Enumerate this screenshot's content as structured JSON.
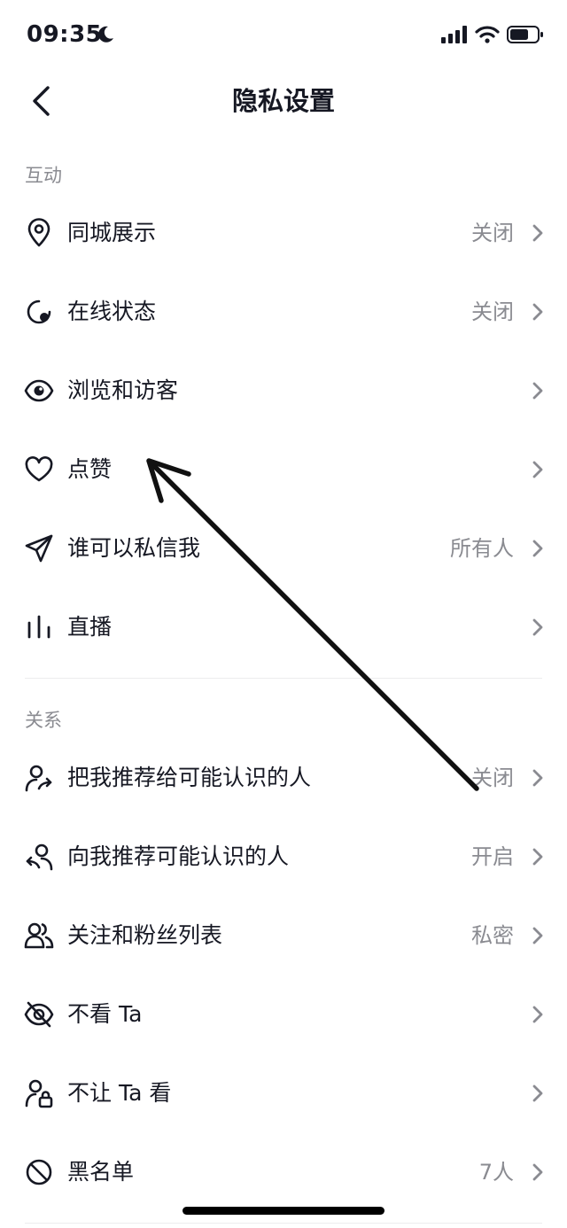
{
  "status": {
    "time": "09:35"
  },
  "nav": {
    "title": "隐私设置"
  },
  "sections": {
    "interaction": {
      "title": "互动",
      "items": [
        {
          "label": "同城展示",
          "value": "关闭"
        },
        {
          "label": "在线状态",
          "value": "关闭"
        },
        {
          "label": "浏览和访客",
          "value": ""
        },
        {
          "label": "点赞",
          "value": ""
        },
        {
          "label": "谁可以私信我",
          "value": "所有人"
        },
        {
          "label": "直播",
          "value": ""
        }
      ]
    },
    "relations": {
      "title": "关系",
      "items": [
        {
          "label": "把我推荐给可能认识的人",
          "value": "关闭"
        },
        {
          "label": "向我推荐可能认识的人",
          "value": "开启"
        },
        {
          "label": "关注和粉丝列表",
          "value": "私密"
        },
        {
          "label": "不看 Ta",
          "value": ""
        },
        {
          "label": "不让 Ta 看",
          "value": ""
        },
        {
          "label": "黑名单",
          "value": "7人"
        }
      ]
    }
  },
  "colors": {
    "text": "#161823",
    "secondary": "#8a8b91",
    "divider": "#ececee"
  }
}
